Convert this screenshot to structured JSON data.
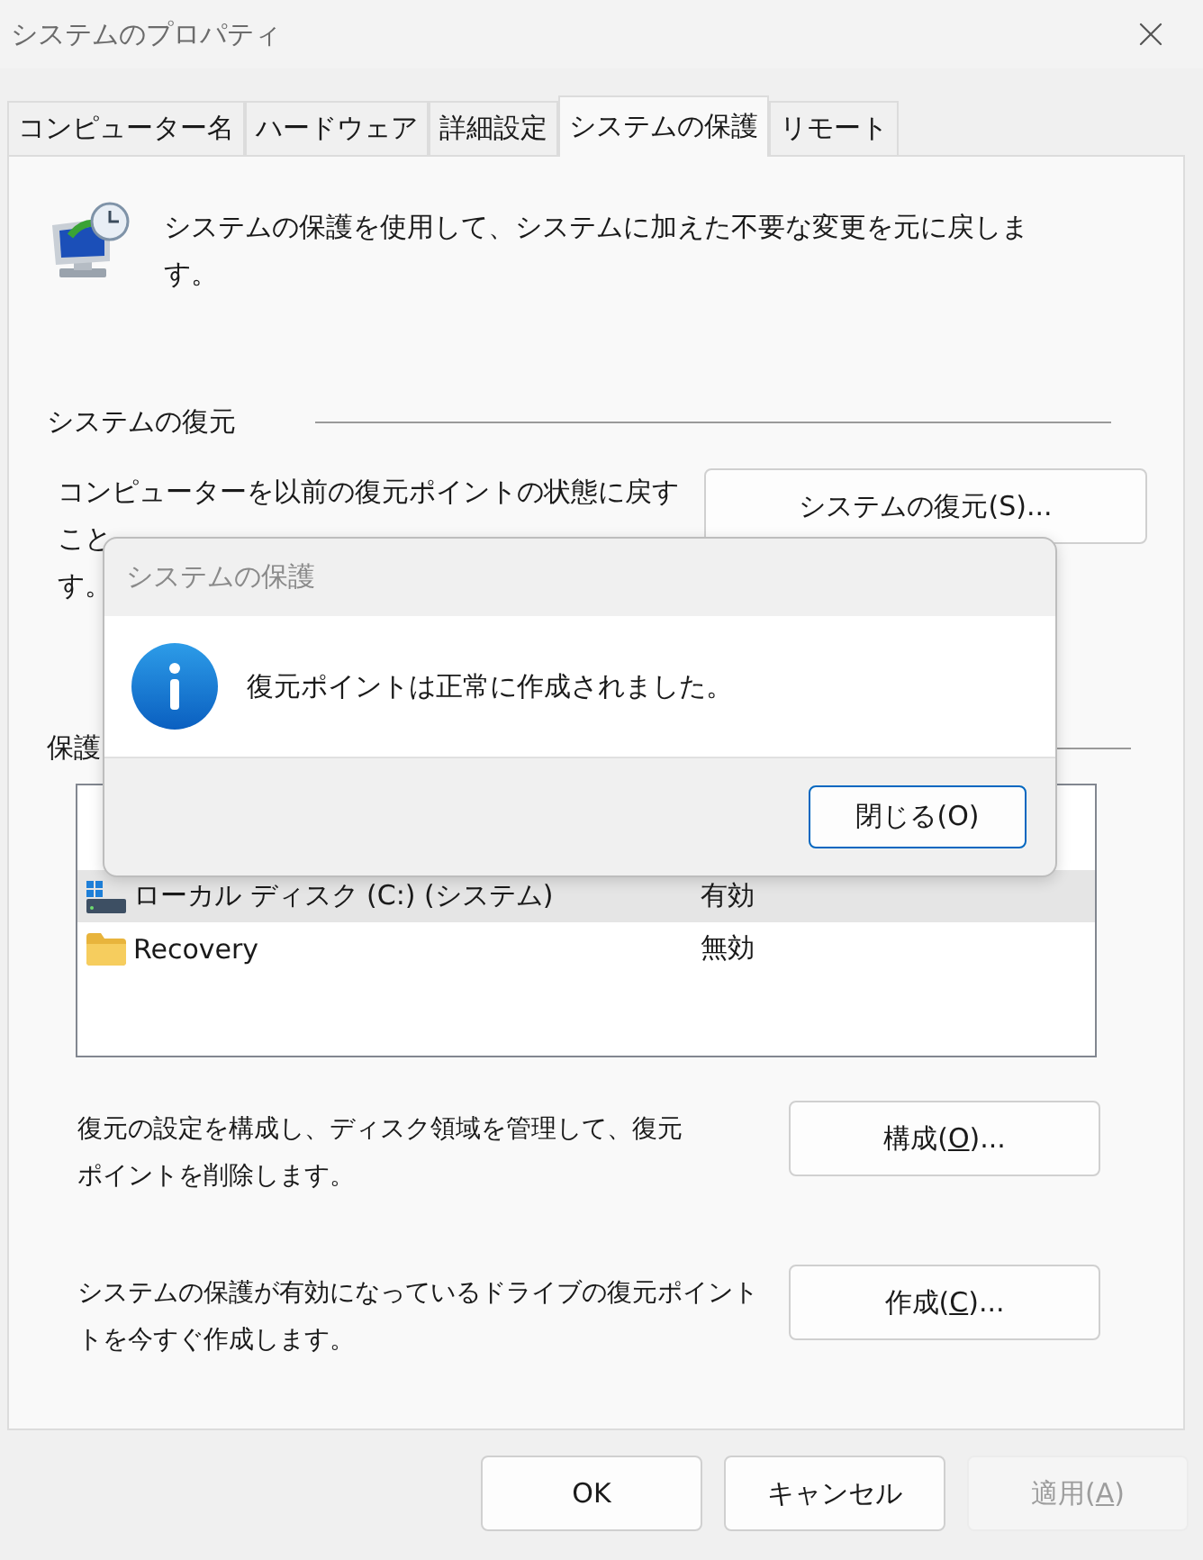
{
  "window": {
    "title": "システムのプロパティ"
  },
  "tabs": [
    {
      "label": "コンピューター名",
      "selected": false
    },
    {
      "label": "ハードウェア",
      "selected": false
    },
    {
      "label": "詳細設定",
      "selected": false
    },
    {
      "label": "システムの保護",
      "selected": true
    },
    {
      "label": "リモート",
      "selected": false
    }
  ],
  "intro": "システムの保護を使用して、システムに加えた不要な変更を元に戻します。",
  "restore": {
    "heading": "システムの復元",
    "description": [
      "コンピューターを以前の復元ポイントの状態に戻す",
      "こと",
      "す。"
    ],
    "button": "システムの復元(S)..."
  },
  "protection": {
    "heading": "保護",
    "drives": [
      {
        "kind": "drive",
        "name": "ローカル ディスク (C:) (システム)",
        "status": "有効",
        "selected": true
      },
      {
        "kind": "folder",
        "name": "Recovery",
        "status": "無効",
        "selected": false
      }
    ]
  },
  "actions": [
    {
      "text": [
        "復元の設定を構成し、ディスク領域を管理して、復元",
        "ポイントを削除します。"
      ],
      "label": "構成(",
      "access_key": "O",
      "label_after": ")..."
    },
    {
      "text": [
        "システムの保護が有効になっているドライブの復元ポイント",
        "トを今すぐ作成します。"
      ],
      "label": "作成(",
      "access_key": "C",
      "label_after": ")..."
    }
  ],
  "footer_buttons": [
    {
      "label": "OK",
      "disabled": false
    },
    {
      "label": "キャンセル",
      "disabled": false
    },
    {
      "label": "適用(",
      "access_key": "A",
      "label_after": ")",
      "disabled": true
    }
  ],
  "dialog": {
    "title": "システムの保護",
    "message": "復元ポイントは正常に作成されました。",
    "button": "閉じる(O)"
  }
}
